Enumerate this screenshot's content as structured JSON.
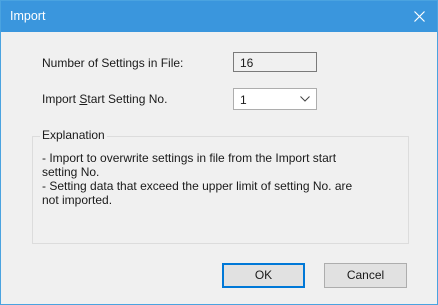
{
  "window": {
    "title": "Import",
    "close_icon": "close-icon"
  },
  "fields": {
    "count_label": "Number of Settings in File:",
    "count_value": "16",
    "start_label_pre": "Import ",
    "start_label_ul": "S",
    "start_label_post": "tart Setting No.",
    "start_value": "1"
  },
  "explanation": {
    "title": "Explanation",
    "lines": [
      "- Import to overwrite settings in file from the Import start",
      "setting No.",
      "- Setting data that exceed the upper limit of setting No. are",
      "not imported."
    ]
  },
  "buttons": {
    "ok": "OK",
    "cancel": "Cancel"
  },
  "colors": {
    "titlebar": "#3a96dd",
    "dialog_bg": "#f0f0f0",
    "focus": "#0078d7"
  }
}
